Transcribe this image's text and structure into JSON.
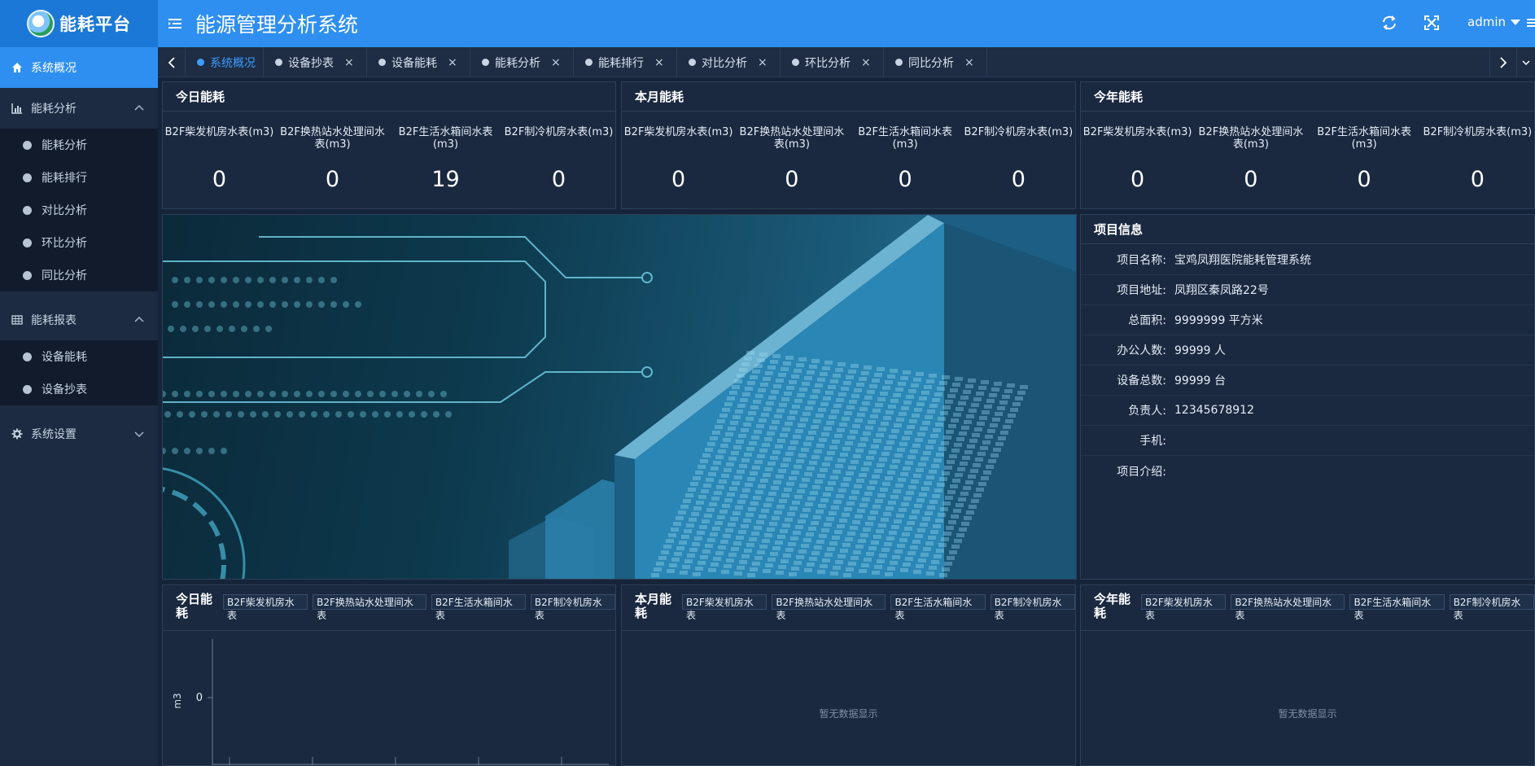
{
  "header": {
    "logo_text": "能耗平台",
    "title": "能源管理分析系统",
    "user": "admin",
    "refresh_icon": "refresh-icon",
    "fullscreen_icon": "fullscreen-icon"
  },
  "sidebar": {
    "items": [
      {
        "label": "系统概况",
        "icon": "home-icon",
        "active": true
      },
      {
        "label": "能耗分析",
        "icon": "bar-chart-icon",
        "expanded": true,
        "children": [
          "能耗分析",
          "能耗排行",
          "对比分析",
          "环比分析",
          "同比分析"
        ]
      },
      {
        "label": "能耗报表",
        "icon": "table-icon",
        "expanded": true,
        "children": [
          "设备能耗",
          "设备抄表"
        ]
      },
      {
        "label": "系统设置",
        "icon": "gear-icon",
        "expanded": false
      }
    ]
  },
  "tabs": [
    {
      "label": "系统概况",
      "active": true
    },
    {
      "label": "设备抄表"
    },
    {
      "label": "设备能耗"
    },
    {
      "label": "能耗分析"
    },
    {
      "label": "能耗排行"
    },
    {
      "label": "对比分析"
    },
    {
      "label": "环比分析"
    },
    {
      "label": "同比分析"
    }
  ],
  "summary": [
    {
      "title": "今日能耗",
      "stats": [
        {
          "label": "B2F柴发机房水表(m3)",
          "value": "0"
        },
        {
          "label": "B2F换热站水处理间水表(m3)",
          "value": "0"
        },
        {
          "label": "B2F生活水箱间水表(m3)",
          "value": "19"
        },
        {
          "label": "B2F制冷机房水表(m3)",
          "value": "0"
        }
      ]
    },
    {
      "title": "本月能耗",
      "stats": [
        {
          "label": "B2F柴发机房水表(m3)",
          "value": "0"
        },
        {
          "label": "B2F换热站水处理间水表(m3)",
          "value": "0"
        },
        {
          "label": "B2F生活水箱间水表(m3)",
          "value": "0"
        },
        {
          "label": "B2F制冷机房水表(m3)",
          "value": "0"
        }
      ]
    },
    {
      "title": "今年能耗",
      "stats": [
        {
          "label": "B2F柴发机房水表(m3)",
          "value": "0"
        },
        {
          "label": "B2F换热站水处理间水表(m3)",
          "value": "0"
        },
        {
          "label": "B2F生活水箱间水表(m3)",
          "value": "0"
        },
        {
          "label": "B2F制冷机房水表(m3)",
          "value": "0"
        }
      ]
    }
  ],
  "project": {
    "title": "项目信息",
    "rows": [
      {
        "label": "项目名称:",
        "value": "宝鸡凤翔医院能耗管理系统"
      },
      {
        "label": "项目地址:",
        "value": "凤翔区秦凤路22号"
      },
      {
        "label": "总面积:",
        "value": "9999999 平方米"
      },
      {
        "label": "办公人数:",
        "value": "99999 人"
      },
      {
        "label": "设备总数:",
        "value": "99999 台"
      },
      {
        "label": "负责人:",
        "value": "12345678912"
      },
      {
        "label": "手机:",
        "value": ""
      },
      {
        "label": "项目介绍:",
        "value": ""
      }
    ]
  },
  "charts": [
    {
      "title": "今日能耗",
      "chips": [
        "B2F柴发机房水表",
        "B2F换热站水处理间水表",
        "B2F生活水箱间水表",
        "B2F制冷机房水表"
      ],
      "nodata": ""
    },
    {
      "title": "本月能耗",
      "chips": [
        "B2F柴发机房水表",
        "B2F换热站水处理间水表",
        "B2F生活水箱间水表",
        "B2F制冷机房水表"
      ],
      "nodata": "暂无数据显示"
    },
    {
      "title": "今年能耗",
      "chips": [
        "B2F柴发机房水表",
        "B2F换热站水处理间水表",
        "B2F生活水箱间水表",
        "B2F制冷机房水表"
      ],
      "nodata": "暂无数据显示"
    }
  ],
  "chart_data": {
    "type": "bar",
    "title": "今日能耗",
    "ylabel": "m3",
    "yticks": [
      "0"
    ],
    "categories": [],
    "series": []
  }
}
